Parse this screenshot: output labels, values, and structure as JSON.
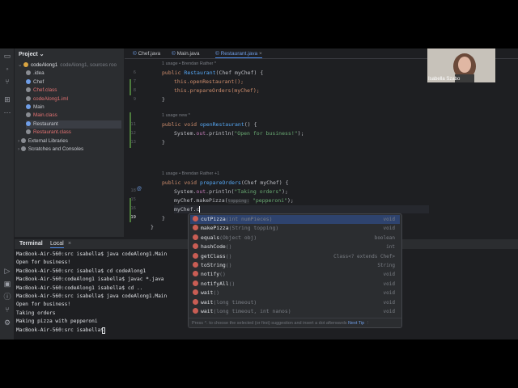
{
  "toolstrip": {
    "icons": [
      "folder-icon",
      "commit-icon",
      "branches-icon",
      "structure-icon",
      "more-icon",
      "run-icon",
      "terminal-icon",
      "problems-icon",
      "git-icon",
      "services-icon"
    ]
  },
  "project": {
    "header": "Project",
    "items": [
      {
        "label": "codeAlong1",
        "suffix": "codeAlong1, sources roo",
        "depth": 0,
        "color": "#dfe1e5",
        "icon": "module"
      },
      {
        "label": ".idea",
        "depth": 1,
        "color": "#c8cad0",
        "icon": "folder"
      },
      {
        "label": "Chef",
        "depth": 1,
        "color": "#c8cad0",
        "icon": "class"
      },
      {
        "label": "Chef.class",
        "depth": 1,
        "color": "#e57373",
        "icon": "file"
      },
      {
        "label": "codeAlong1.iml",
        "depth": 1,
        "color": "#e57373",
        "icon": "file"
      },
      {
        "label": "Main",
        "depth": 1,
        "color": "#c8cad0",
        "icon": "class"
      },
      {
        "label": "Main.class",
        "depth": 1,
        "color": "#e57373",
        "icon": "file"
      },
      {
        "label": "Restaurant",
        "depth": 1,
        "color": "#c8cad0",
        "icon": "class",
        "selected": true
      },
      {
        "label": "Restaurant.class",
        "depth": 1,
        "color": "#e57373",
        "icon": "file"
      },
      {
        "label": "External Libraries",
        "depth": 0,
        "color": "#c8cad0",
        "icon": "lib"
      },
      {
        "label": "Scratches and Consoles",
        "depth": 0,
        "color": "#c8cad0",
        "icon": "scratch"
      }
    ]
  },
  "tabs": [
    {
      "label": "Chef.java",
      "active": false
    },
    {
      "label": "Main.java",
      "active": false
    },
    {
      "label": "Restaurant.java",
      "active": true
    }
  ],
  "editor": {
    "lens1": "1 usage  • Brendan Rather *",
    "lens2": "1 usage   new *",
    "lens3": "1 usage  • Brendan Rather +1",
    "ln_a": "6",
    "ln_b": "7",
    "ln_c": "8",
    "ln_d": "9",
    "ln_e": "10",
    "ln_f": "11",
    "ln_g": "12",
    "ln_h": "13",
    "ln_i": "14",
    "ln_j": "15",
    "ln_k": "16",
    "ln_l": "17",
    "ln_m": "18",
    "ln_n": "19",
    "ln_o": "20",
    "ln_p": "21",
    "ln_q": "22",
    "c1_kw": "public",
    "c1_fn": "Restaurant",
    "c1_rest": "(Chef myChef) {",
    "c2_call": "this.openRestaurant();",
    "c3_call": "this.prepareOrders(myChef);",
    "close": "}",
    "c5_kw": "public void",
    "c5_fn": "openRestaurant",
    "c5_rest": "() {",
    "c6_a": "System.",
    "c6_out": "out",
    "c6_b": ".println(",
    "c6_str": "\"Open for business!\"",
    "c6_c": ");",
    "c9_kw": "public void",
    "c9_fn": "prepareOrders",
    "c9_rest": "(Chef myChef) {",
    "c10_a": "System.",
    "c10_out": "out",
    "c10_b": ".println(",
    "c10_str": "\"Taking orders\"",
    "c10_c": ");",
    "c11_a": "myChef.makePizza(",
    "c11_hint": "topping:",
    "c11_str": "\"pepperoni\"",
    "c11_c": ");",
    "c12": "myChef.c"
  },
  "completion": {
    "items": [
      {
        "name": "cutPizza",
        "params": "(int numPieces)",
        "ret": "void",
        "highlight": true
      },
      {
        "name": "makePizza",
        "params": "(String topping)",
        "ret": "void"
      },
      {
        "name": "equals",
        "params": "(Object obj)",
        "ret": "boolean"
      },
      {
        "name": "hashCode",
        "params": "()",
        "ret": "int"
      },
      {
        "name": "getClass",
        "params": "()",
        "ret": "Class<? extends Chef>"
      },
      {
        "name": "toString",
        "params": "()",
        "ret": "String"
      },
      {
        "name": "notify",
        "params": "()",
        "ret": "void"
      },
      {
        "name": "notifyAll",
        "params": "()",
        "ret": "void"
      },
      {
        "name": "wait",
        "params": "()",
        "ret": "void"
      },
      {
        "name": "wait",
        "params": "(long timeout)",
        "ret": "void"
      },
      {
        "name": "wait",
        "params": "(long timeout, int nanos)",
        "ret": "void"
      }
    ],
    "footer": "Press ^. to choose the selected (or first) suggestion and insert a dot afterwards",
    "next_tip": "Next Tip"
  },
  "terminal": {
    "tab_terminal": "Terminal",
    "tab_local": "Local",
    "lines": [
      "MacBook-Air-560:src isabella$ java codeAlong1.Main",
      "Open for business!",
      "MacBook-Air-560:src isabella$ cd codeAlong1",
      "MacBook-Air-560:codeAlong1 isabella$ javac *.java",
      "MacBook-Air-560:codeAlong1 isabella$ cd ..",
      "MacBook-Air-560:src isabella$ java codeAlong1.Main",
      "Open for business!",
      "Taking orders",
      "Making pizza with pepperoni",
      "MacBook-Air-560:src isabella$ "
    ]
  },
  "webcam": {
    "name": "Isabella Szabo"
  }
}
